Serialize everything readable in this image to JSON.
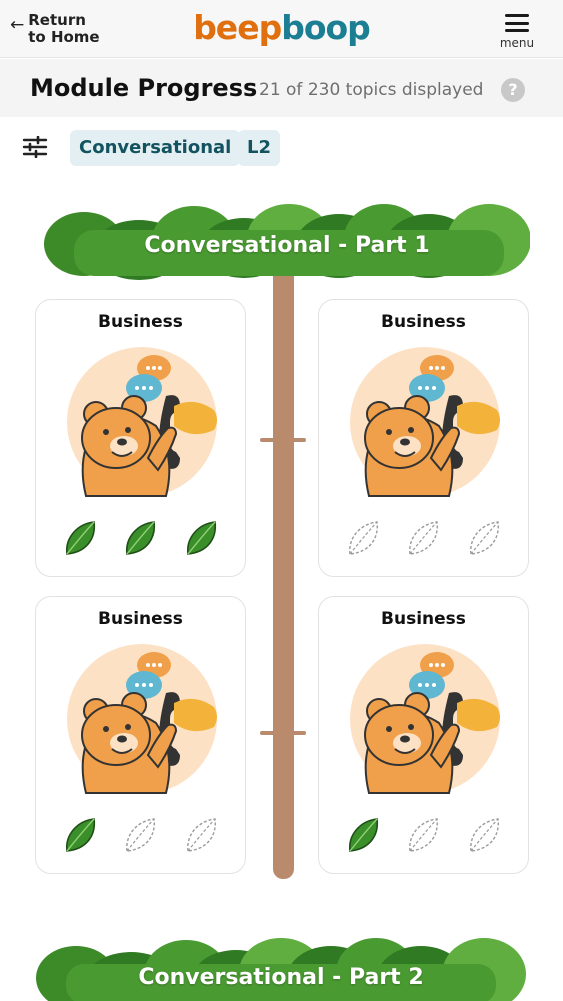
{
  "header": {
    "back_label": "Return to Home",
    "logo_beep": "beep",
    "logo_boop": "boop",
    "menu_label": "menu"
  },
  "progress": {
    "title": "Module Progress",
    "topics_text": "21 of 230 topics displayed"
  },
  "filters": {
    "chips": [
      "Conversational",
      "L2"
    ]
  },
  "sections": [
    {
      "title": "Conversational - Part 1",
      "cards": [
        {
          "label": "Business",
          "leaves_completed": 3,
          "leaves_total": 3
        },
        {
          "label": "Business",
          "leaves_completed": 0,
          "leaves_total": 3
        },
        {
          "label": "Business",
          "leaves_completed": 1,
          "leaves_total": 3
        },
        {
          "label": "Business",
          "leaves_completed": 1,
          "leaves_total": 3
        }
      ]
    },
    {
      "title": "Conversational - Part 2"
    }
  ],
  "colors": {
    "logo_beep": "#e0700f",
    "logo_boop": "#1b7e93",
    "leaf_green": "#3a8f2a",
    "trunk": "#b98a6c",
    "chip_bg": "#e3eff2"
  },
  "icons": [
    "back-arrow-icon",
    "menu-icon",
    "help-icon",
    "filter-sliders-icon",
    "leaf-icon"
  ]
}
